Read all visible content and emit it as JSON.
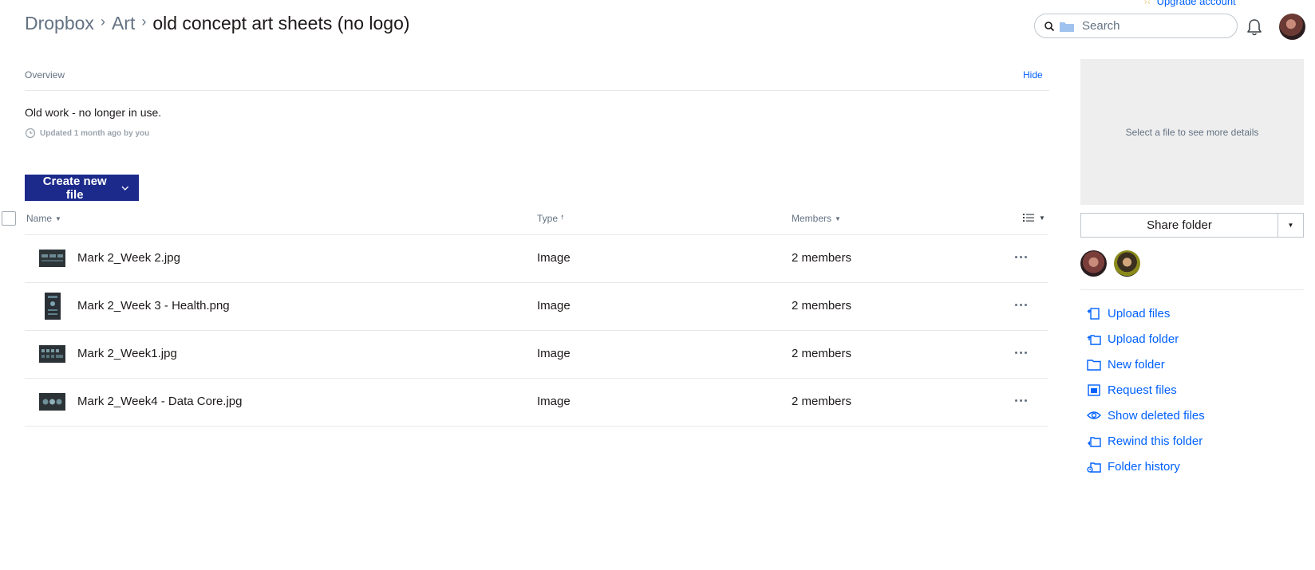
{
  "header": {
    "upgrade_label": "Upgrade account",
    "breadcrumb": [
      "Dropbox",
      "Art",
      "old concept art sheets (no logo)"
    ],
    "search_placeholder": "Search"
  },
  "overview": {
    "label": "Overview",
    "hide_label": "Hide",
    "description": "Old work - no longer in use.",
    "updated": "Updated 1 month ago by you"
  },
  "create_button_label": "Create new file",
  "table": {
    "columns": {
      "name": "Name",
      "type": "Type",
      "members": "Members"
    },
    "rows": [
      {
        "name": "Mark 2_Week 2.jpg",
        "type": "Image",
        "members": "2 members"
      },
      {
        "name": "Mark 2_Week 3 - Health.png",
        "type": "Image",
        "members": "2 members"
      },
      {
        "name": "Mark 2_Week1.jpg",
        "type": "Image",
        "members": "2 members"
      },
      {
        "name": "Mark 2_Week4 - Data Core.jpg",
        "type": "Image",
        "members": "2 members"
      }
    ]
  },
  "sidebar": {
    "details_placeholder": "Select a file to see more details",
    "share_label": "Share folder",
    "actions": [
      {
        "label": "Upload files",
        "icon": "upload-file-icon"
      },
      {
        "label": "Upload folder",
        "icon": "upload-folder-icon"
      },
      {
        "label": "New folder",
        "icon": "new-folder-icon"
      },
      {
        "label": "Request files",
        "icon": "request-files-icon"
      },
      {
        "label": "Show deleted files",
        "icon": "eye-icon"
      },
      {
        "label": "Rewind this folder",
        "icon": "rewind-icon"
      },
      {
        "label": "Folder history",
        "icon": "history-icon"
      }
    ]
  },
  "colors": {
    "brand_dark": "#1b2a8b",
    "link": "#0061fe",
    "muted": "#637282"
  }
}
